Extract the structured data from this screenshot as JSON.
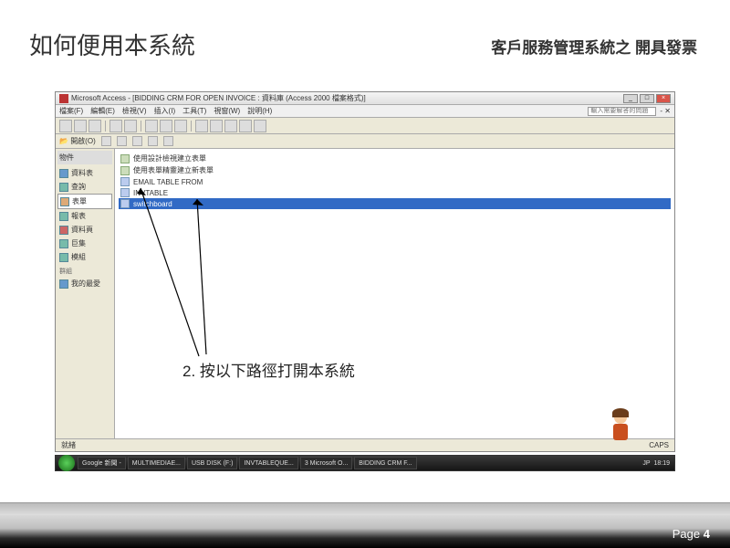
{
  "slide": {
    "title": "如何便用本系統",
    "subtitle": "客戶服務管理系統之 開具發票",
    "instruction": "2. 按以下路徑打開本系統",
    "page_label": "Page",
    "page_number": "4"
  },
  "window": {
    "title": "Microsoft Access - [BIDDING CRM FOR OPEN INVOICE : 資料庫 (Access 2000 檔案格式)]",
    "help_placeholder": "輸入需要解答的問題"
  },
  "menubar": [
    "檔案(F)",
    "編輯(E)",
    "檢視(V)",
    "插入(I)",
    "工具(T)",
    "視窗(W)",
    "說明(H)"
  ],
  "subtoolbar": {
    "open": "開啟(O)"
  },
  "nav": {
    "header": "物件",
    "items": [
      "資料表",
      "查詢",
      "表單",
      "報表",
      "資料頁",
      "巨集",
      "模組"
    ],
    "selected_index": 2,
    "group": "群組",
    "group_item": "我的最愛"
  },
  "objects": [
    "使用設計檢視建立表單",
    "使用表單精靈建立新表單",
    "EMAIL TABLE FROM",
    "INVTABLE",
    "switchboard"
  ],
  "objects_selected_index": 4,
  "statusbar": {
    "left": "就緒",
    "caps": "CAPS"
  },
  "taskbar": {
    "items": [
      "Google 新聞 -",
      "MULTIMEDIAE...",
      "USB DISK (F:)",
      "INVTABLEQUE...",
      "3 Microsoft O...",
      "BIDDING CRM F..."
    ],
    "lang": "JP",
    "clock": "18:19"
  }
}
